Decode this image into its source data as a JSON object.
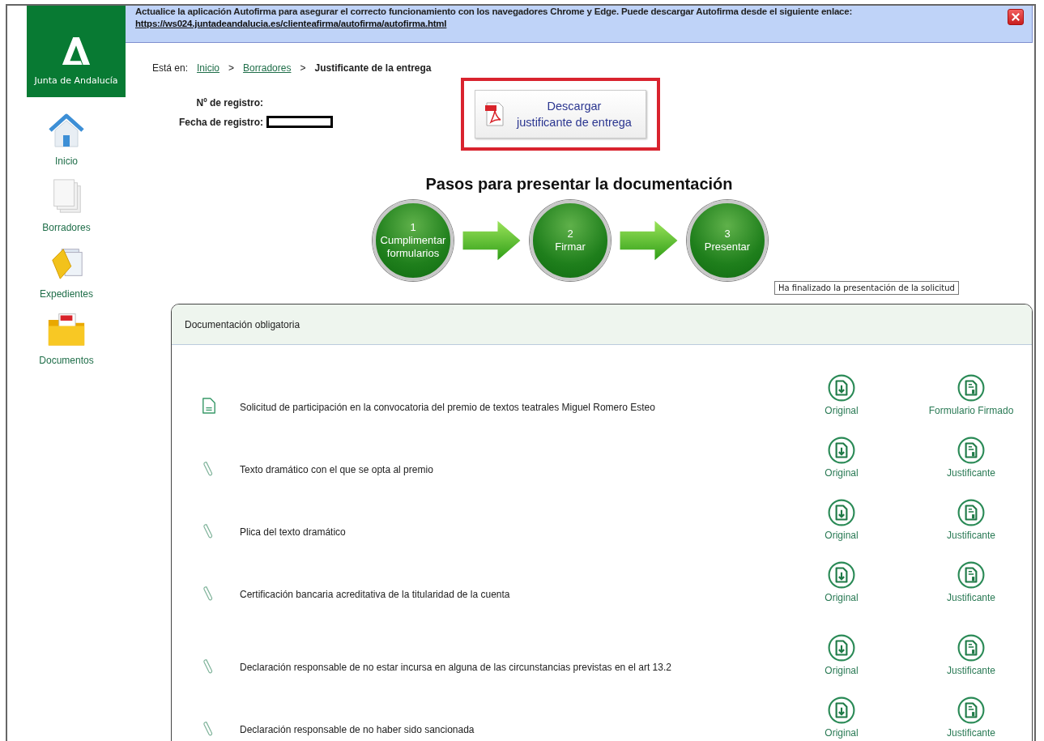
{
  "banner": {
    "message": "Actualice la aplicación Autofirma para asegurar el correcto funcionamiento con los navegadores Chrome y Edge. Puede descargar Autofirma desde el siguiente enlace:",
    "link": "https://ws024.juntadeandalucia.es/clienteafirma/autofirma/autofirma.html"
  },
  "sidebar": {
    "logo_text": "Junta de Andalucía",
    "items": [
      {
        "label": "Inicio",
        "kind": "home"
      },
      {
        "label": "Borradores",
        "kind": "drafts"
      },
      {
        "label": "Expedientes",
        "kind": "folder"
      },
      {
        "label": "Documentos",
        "kind": "pdf-folder"
      }
    ]
  },
  "breadcrumb": [
    {
      "label": "Está en:",
      "kind": "prefix"
    },
    {
      "label": "Inicio",
      "kind": "link"
    },
    {
      "label": ">",
      "kind": "separator"
    },
    {
      "label": "Borradores",
      "kind": "link"
    },
    {
      "label": ">",
      "kind": "separator"
    },
    {
      "label": "Justificante de la entrega",
      "kind": "current"
    }
  ],
  "registry": [
    {
      "label": "Nº de registro:",
      "redacted": false
    },
    {
      "label": "Fecha de registro:",
      "redacted": true
    }
  ],
  "download_button": {
    "lines": [
      "Descargar",
      "justificante de entrega"
    ],
    "highlighted": true
  },
  "steps": {
    "title": "Pasos para presentar la documentación",
    "items": [
      {
        "number": "1",
        "label": "Cumplimentar formularios"
      },
      {
        "number": "2",
        "label": "Firmar"
      },
      {
        "number": "3",
        "label": "Presentar"
      }
    ],
    "tooltip": "Ha finalizado la presentación de la solicitud"
  },
  "documents": {
    "title": "Documentación obligatoria",
    "rows": [
      {
        "kind": "form",
        "name": "Solicitud de participación en la convocatoria del premio de textos teatrales Miguel Romero Esteo",
        "actions": [
          {
            "kind": "download",
            "label": "Original"
          },
          {
            "kind": "receipt",
            "label": "Formulario Firmado"
          }
        ]
      },
      {
        "kind": "attachment",
        "name": "Texto dramático con el que se opta al premio",
        "actions": [
          {
            "kind": "download",
            "label": "Original"
          },
          {
            "kind": "receipt",
            "label": "Justificante"
          }
        ]
      },
      {
        "kind": "attachment",
        "name": "Plica del texto dramático",
        "actions": [
          {
            "kind": "download",
            "label": "Original"
          },
          {
            "kind": "receipt",
            "label": "Justificante"
          }
        ]
      },
      {
        "kind": "attachment",
        "name": "Certificación bancaria acreditativa de la titularidad de la cuenta",
        "actions": [
          {
            "kind": "download",
            "label": "Original"
          },
          {
            "kind": "receipt",
            "label": "Justificante"
          }
        ]
      },
      {
        "kind": "attachment",
        "name": "Declaración responsable de no estar incursa en alguna de las circunstancias previstas en el art 13.2",
        "actions": [
          {
            "kind": "download",
            "label": "Original"
          },
          {
            "kind": "receipt",
            "label": "Justificante"
          }
        ]
      },
      {
        "kind": "attachment",
        "name": "Declaración responsable de no haber sido sancionada",
        "actions": [
          {
            "kind": "download",
            "label": "Original"
          },
          {
            "kind": "receipt",
            "label": "Justificante"
          }
        ]
      }
    ]
  }
}
